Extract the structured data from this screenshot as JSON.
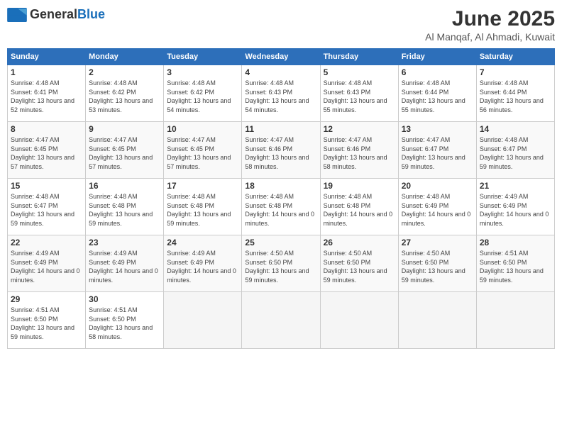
{
  "header": {
    "logo_general": "General",
    "logo_blue": "Blue",
    "month": "June 2025",
    "location": "Al Manqaf, Al Ahmadi, Kuwait"
  },
  "weekdays": [
    "Sunday",
    "Monday",
    "Tuesday",
    "Wednesday",
    "Thursday",
    "Friday",
    "Saturday"
  ],
  "weeks": [
    [
      {
        "day": "1",
        "sunrise": "Sunrise: 4:48 AM",
        "sunset": "Sunset: 6:41 PM",
        "daylight": "Daylight: 13 hours and 52 minutes."
      },
      {
        "day": "2",
        "sunrise": "Sunrise: 4:48 AM",
        "sunset": "Sunset: 6:42 PM",
        "daylight": "Daylight: 13 hours and 53 minutes."
      },
      {
        "day": "3",
        "sunrise": "Sunrise: 4:48 AM",
        "sunset": "Sunset: 6:42 PM",
        "daylight": "Daylight: 13 hours and 54 minutes."
      },
      {
        "day": "4",
        "sunrise": "Sunrise: 4:48 AM",
        "sunset": "Sunset: 6:43 PM",
        "daylight": "Daylight: 13 hours and 54 minutes."
      },
      {
        "day": "5",
        "sunrise": "Sunrise: 4:48 AM",
        "sunset": "Sunset: 6:43 PM",
        "daylight": "Daylight: 13 hours and 55 minutes."
      },
      {
        "day": "6",
        "sunrise": "Sunrise: 4:48 AM",
        "sunset": "Sunset: 6:44 PM",
        "daylight": "Daylight: 13 hours and 55 minutes."
      },
      {
        "day": "7",
        "sunrise": "Sunrise: 4:48 AM",
        "sunset": "Sunset: 6:44 PM",
        "daylight": "Daylight: 13 hours and 56 minutes."
      }
    ],
    [
      {
        "day": "8",
        "sunrise": "Sunrise: 4:47 AM",
        "sunset": "Sunset: 6:45 PM",
        "daylight": "Daylight: 13 hours and 57 minutes."
      },
      {
        "day": "9",
        "sunrise": "Sunrise: 4:47 AM",
        "sunset": "Sunset: 6:45 PM",
        "daylight": "Daylight: 13 hours and 57 minutes."
      },
      {
        "day": "10",
        "sunrise": "Sunrise: 4:47 AM",
        "sunset": "Sunset: 6:45 PM",
        "daylight": "Daylight: 13 hours and 57 minutes."
      },
      {
        "day": "11",
        "sunrise": "Sunrise: 4:47 AM",
        "sunset": "Sunset: 6:46 PM",
        "daylight": "Daylight: 13 hours and 58 minutes."
      },
      {
        "day": "12",
        "sunrise": "Sunrise: 4:47 AM",
        "sunset": "Sunset: 6:46 PM",
        "daylight": "Daylight: 13 hours and 58 minutes."
      },
      {
        "day": "13",
        "sunrise": "Sunrise: 4:47 AM",
        "sunset": "Sunset: 6:47 PM",
        "daylight": "Daylight: 13 hours and 59 minutes."
      },
      {
        "day": "14",
        "sunrise": "Sunrise: 4:48 AM",
        "sunset": "Sunset: 6:47 PM",
        "daylight": "Daylight: 13 hours and 59 minutes."
      }
    ],
    [
      {
        "day": "15",
        "sunrise": "Sunrise: 4:48 AM",
        "sunset": "Sunset: 6:47 PM",
        "daylight": "Daylight: 13 hours and 59 minutes."
      },
      {
        "day": "16",
        "sunrise": "Sunrise: 4:48 AM",
        "sunset": "Sunset: 6:48 PM",
        "daylight": "Daylight: 13 hours and 59 minutes."
      },
      {
        "day": "17",
        "sunrise": "Sunrise: 4:48 AM",
        "sunset": "Sunset: 6:48 PM",
        "daylight": "Daylight: 13 hours and 59 minutes."
      },
      {
        "day": "18",
        "sunrise": "Sunrise: 4:48 AM",
        "sunset": "Sunset: 6:48 PM",
        "daylight": "Daylight: 14 hours and 0 minutes."
      },
      {
        "day": "19",
        "sunrise": "Sunrise: 4:48 AM",
        "sunset": "Sunset: 6:48 PM",
        "daylight": "Daylight: 14 hours and 0 minutes."
      },
      {
        "day": "20",
        "sunrise": "Sunrise: 4:48 AM",
        "sunset": "Sunset: 6:49 PM",
        "daylight": "Daylight: 14 hours and 0 minutes."
      },
      {
        "day": "21",
        "sunrise": "Sunrise: 4:49 AM",
        "sunset": "Sunset: 6:49 PM",
        "daylight": "Daylight: 14 hours and 0 minutes."
      }
    ],
    [
      {
        "day": "22",
        "sunrise": "Sunrise: 4:49 AM",
        "sunset": "Sunset: 6:49 PM",
        "daylight": "Daylight: 14 hours and 0 minutes."
      },
      {
        "day": "23",
        "sunrise": "Sunrise: 4:49 AM",
        "sunset": "Sunset: 6:49 PM",
        "daylight": "Daylight: 14 hours and 0 minutes."
      },
      {
        "day": "24",
        "sunrise": "Sunrise: 4:49 AM",
        "sunset": "Sunset: 6:49 PM",
        "daylight": "Daylight: 14 hours and 0 minutes."
      },
      {
        "day": "25",
        "sunrise": "Sunrise: 4:50 AM",
        "sunset": "Sunset: 6:50 PM",
        "daylight": "Daylight: 13 hours and 59 minutes."
      },
      {
        "day": "26",
        "sunrise": "Sunrise: 4:50 AM",
        "sunset": "Sunset: 6:50 PM",
        "daylight": "Daylight: 13 hours and 59 minutes."
      },
      {
        "day": "27",
        "sunrise": "Sunrise: 4:50 AM",
        "sunset": "Sunset: 6:50 PM",
        "daylight": "Daylight: 13 hours and 59 minutes."
      },
      {
        "day": "28",
        "sunrise": "Sunrise: 4:51 AM",
        "sunset": "Sunset: 6:50 PM",
        "daylight": "Daylight: 13 hours and 59 minutes."
      }
    ],
    [
      {
        "day": "29",
        "sunrise": "Sunrise: 4:51 AM",
        "sunset": "Sunset: 6:50 PM",
        "daylight": "Daylight: 13 hours and 59 minutes."
      },
      {
        "day": "30",
        "sunrise": "Sunrise: 4:51 AM",
        "sunset": "Sunset: 6:50 PM",
        "daylight": "Daylight: 13 hours and 58 minutes."
      },
      null,
      null,
      null,
      null,
      null
    ]
  ]
}
